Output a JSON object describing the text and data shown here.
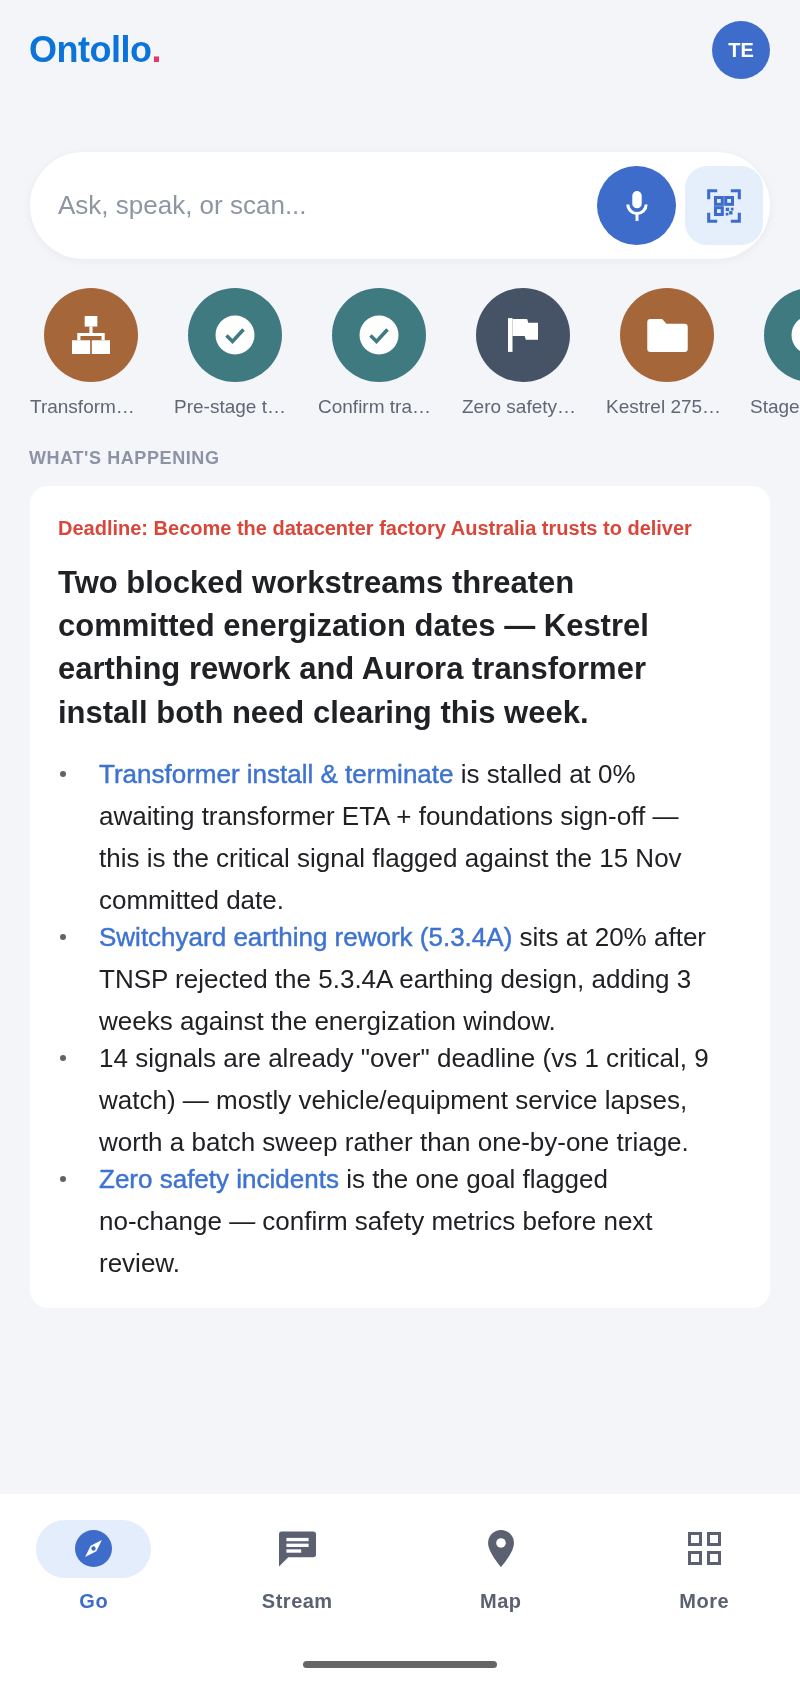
{
  "header": {
    "logo": {
      "name": "Ontollo",
      "accent": "."
    },
    "avatar": {
      "initials": "TE"
    }
  },
  "search": {
    "placeholder": "Ask, speak, or scan..."
  },
  "shortcuts": [
    {
      "label": "Transform…",
      "kind": "hierarchy",
      "color": "#a5673a"
    },
    {
      "label": "Pre-stage t…",
      "kind": "check",
      "color": "#3e7a80"
    },
    {
      "label": "Confirm tra…",
      "kind": "check",
      "color": "#3e7a80"
    },
    {
      "label": "Zero safety…",
      "kind": "flag",
      "color": "#465366"
    },
    {
      "label": "Kestrel 275…",
      "kind": "folder",
      "color": "#a5673a"
    },
    {
      "label": "Stage",
      "kind": "check",
      "color": "#3e7a80"
    }
  ],
  "section_title": "WHAT'S HAPPENING",
  "summary": {
    "deadline": "Deadline: Become the datacenter factory Australia trusts to deliver",
    "headline": "Two blocked workstreams threaten committed energization dates — Kestrel earthing rework and Aurora transformer install both need clearing this week.",
    "bullets": [
      {
        "link": "Transformer install & terminate",
        "text": "is stalled at 0% awaiting transformer ETA + foundations sign-off — this is the critical signal flagged against the 15 Nov committed date."
      },
      {
        "link": "Switchyard earthing rework (5.3.4A)",
        "text": "sits at 20% after TNSP rejected the 5.3.4A earthing design, adding 3 weeks against the energization window."
      },
      {
        "text": "14 signals are already \"over\" deadline (vs 1 critical, 9 watch) — mostly vehicle/equipment service lapses, worth a batch sweep rather than one-by-one triage."
      },
      {
        "link": "Zero safety incidents",
        "text": "is the one goal flagged no-change — confirm safety metrics before next review."
      }
    ]
  },
  "nav": [
    {
      "label": "Go",
      "kind": "compass",
      "selected": true
    },
    {
      "label": "Stream",
      "kind": "chat",
      "selected": false
    },
    {
      "label": "Map",
      "kind": "pin",
      "selected": false
    },
    {
      "label": "More",
      "kind": "grid",
      "selected": false
    }
  ]
}
